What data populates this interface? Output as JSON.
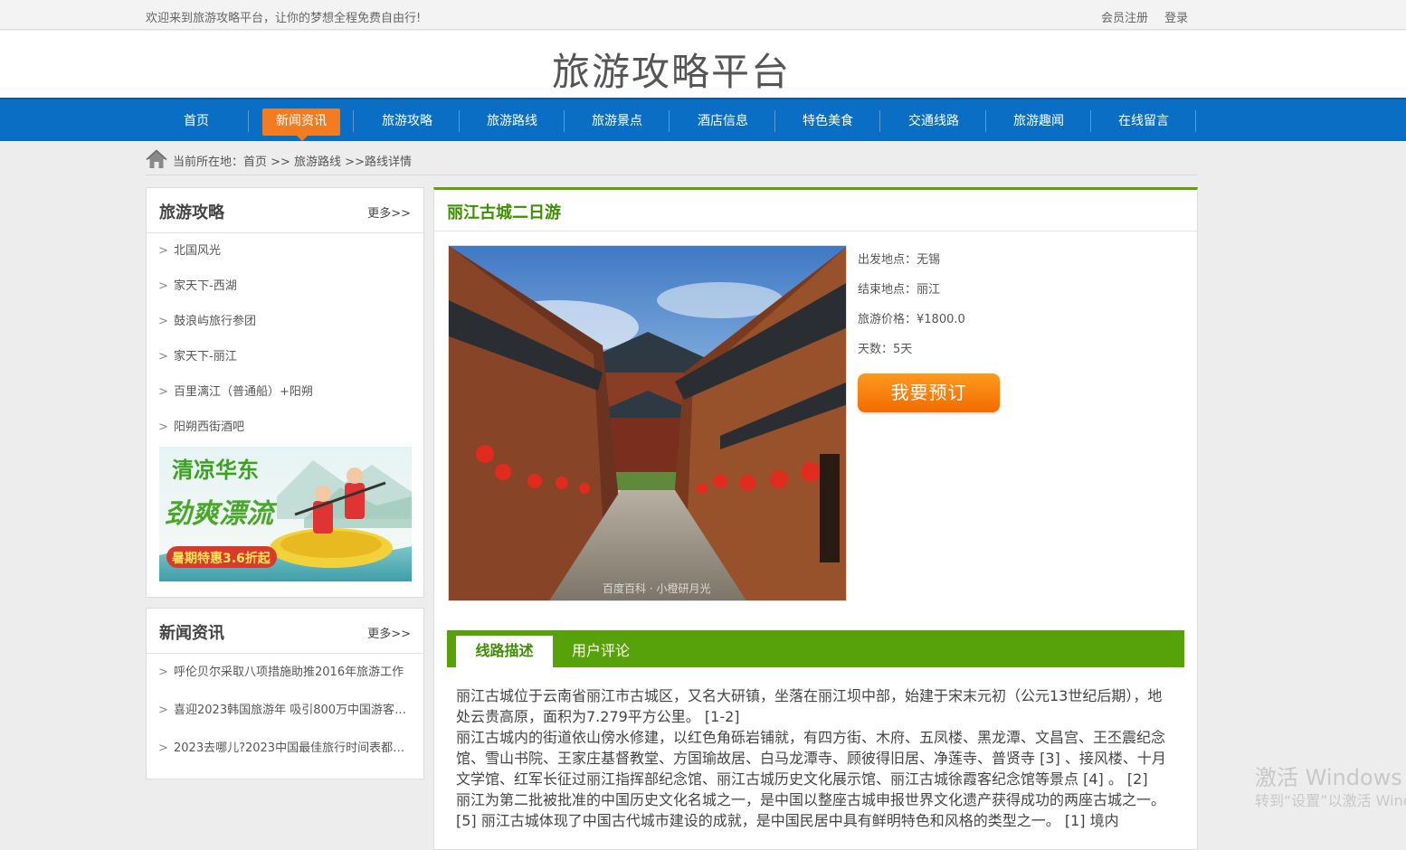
{
  "topbar": {
    "welcome": "欢迎来到旅游攻略平台，让你的梦想全程免费自由行!",
    "register": "会员注册",
    "login": "登录"
  },
  "header": {
    "site_title": "旅游攻略平台"
  },
  "nav": {
    "items": [
      "首页",
      "新闻资讯",
      "旅游攻略",
      "旅游路线",
      "旅游景点",
      "酒店信息",
      "特色美食",
      "交通线路",
      "旅游趣闻",
      "在线留言"
    ],
    "active_index": 1
  },
  "breadcrumb": {
    "text": "当前所在地：首页 >> 旅游路线 >>路线详情"
  },
  "sidebar": {
    "guides": {
      "title": "旅游攻略",
      "more": "更多>>",
      "items": [
        "北国风光",
        "家天下-西湖",
        "鼓浪屿旅行参团",
        "家天下-丽江",
        "百里漓江（普通船）+阳朔",
        "阳朔西街酒吧"
      ]
    },
    "promo": {
      "line1": "清凉华东",
      "line2": "劲爽漂流",
      "line3": "暑期特惠3.6折起"
    },
    "news": {
      "title": "新闻资讯",
      "more": "更多>>",
      "items": [
        "呼伦贝尔采取八项措施助推2016年旅游工作",
        "喜迎2023韩国旅游年 吸引800万中国游客…",
        "2023去哪儿?2023中国最佳旅行时间表都…"
      ]
    }
  },
  "route": {
    "title": "丽江古城二日游",
    "photo_caption": "百度百科 · 小橙研月光",
    "start": "出发地点：无锡",
    "end": "结束地点：丽江",
    "price": "旅游价格：¥1800.0",
    "days": "天数：5天",
    "book_button": "我要预订",
    "tabs": [
      "线路描述",
      "用户评论"
    ],
    "description": [
      "丽江古城位于云南省丽江市古城区，又名大研镇，坐落在丽江坝中部，始建于宋末元初（公元13世纪后期），地处云贵高原，面积为7.279平方公里。 [1-2]",
      "丽江古城内的街道依山傍水修建，以红色角砾岩铺就，有四方街、木府、五凤楼、黑龙潭、文昌宫、王丕震纪念馆、雪山书院、王家庄基督教堂、方国瑜故居、白马龙潭寺、顾彼得旧居、净莲寺、普贤寺 [3] 、接风楼、十月文学馆、红军长征过丽江指挥部纪念馆、丽江古城历史文化展示馆、丽江古城徐霞客纪念馆等景点 [4] 。 [2]",
      "丽江为第二批被批准的中国历史文化名城之一，是中国以整座古城申报世界文化遗产获得成功的两座古城之一。 [5] 丽江古城体现了中国古代城市建设的成就，是中国民居中具有鲜明特色和风格的类型之一。 [1] 境内"
    ]
  },
  "watermark": {
    "line1": "激活 Windows",
    "line2": "转到“设置”以激活 Windows。"
  },
  "colors": {
    "nav_blue": "#0a6fc4",
    "nav_active_orange": "#f47c20",
    "accent_green": "#57a10a",
    "book_orange": "#f26b00"
  }
}
